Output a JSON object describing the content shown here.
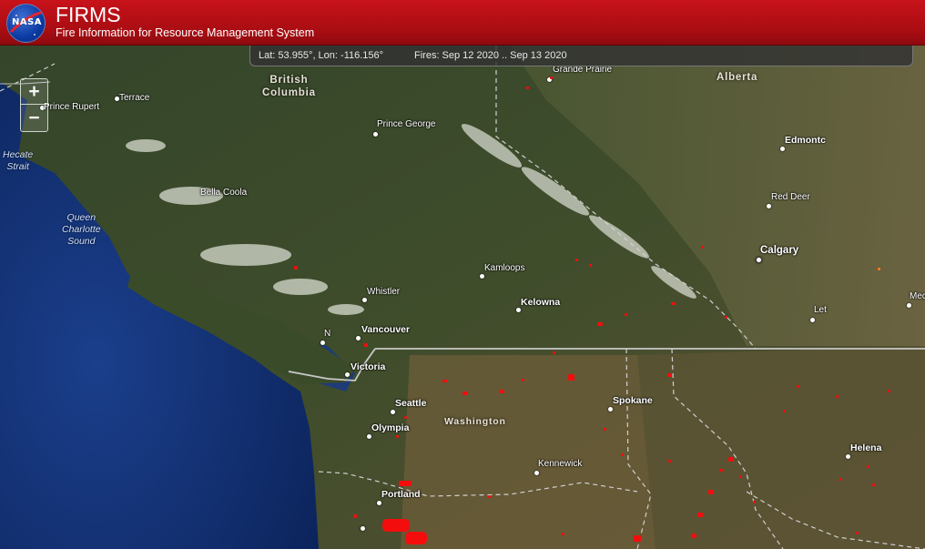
{
  "header": {
    "logo_text": "NASA",
    "title": "FIRMS",
    "subtitle": "Fire Information for Resource Management System"
  },
  "infobar": {
    "coords": "Lat: 53.955°, Lon: -116.156°",
    "fires_range": "Fires: Sep 12 2020 .. Sep 13 2020"
  },
  "zoom": {
    "in_label": "+",
    "out_label": "−"
  },
  "map": {
    "regions": {
      "british_columbia": "British\nColumbia",
      "alberta": "Alberta",
      "washington": "Washington"
    },
    "water": {
      "hecate": "Hecate\nStrait",
      "queen_charlotte": "Queen\nCharlotte\nSound"
    },
    "places": {
      "grande_prairie": "Grande Prairie",
      "terrace": "Terrace",
      "prince_rupert": "Prince Rupert",
      "prince_george": "Prince George",
      "edmonton": "Edmontc",
      "red_deer": "Red Deer",
      "bella_coola": "Bella Coola",
      "calgary": "Calgary",
      "kamloops": "Kamloops",
      "kelowna": "Kelowna",
      "whistler": "Whistler",
      "let": "Let",
      "vancouver": "Vancouver",
      "n": "N",
      "victoria": "Victoria",
      "seattle": "Seattle",
      "spokane": "Spokane",
      "olympia": "Olympia",
      "kennewick": "Kennewick",
      "helena": "Helena",
      "portland": "Portland",
      "mec": "Mec"
    },
    "colors": {
      "fire": "#f40d0d",
      "fire_orange": "#ff7a1a",
      "ocean": "#0f2a66",
      "header": "#b80f15"
    }
  }
}
